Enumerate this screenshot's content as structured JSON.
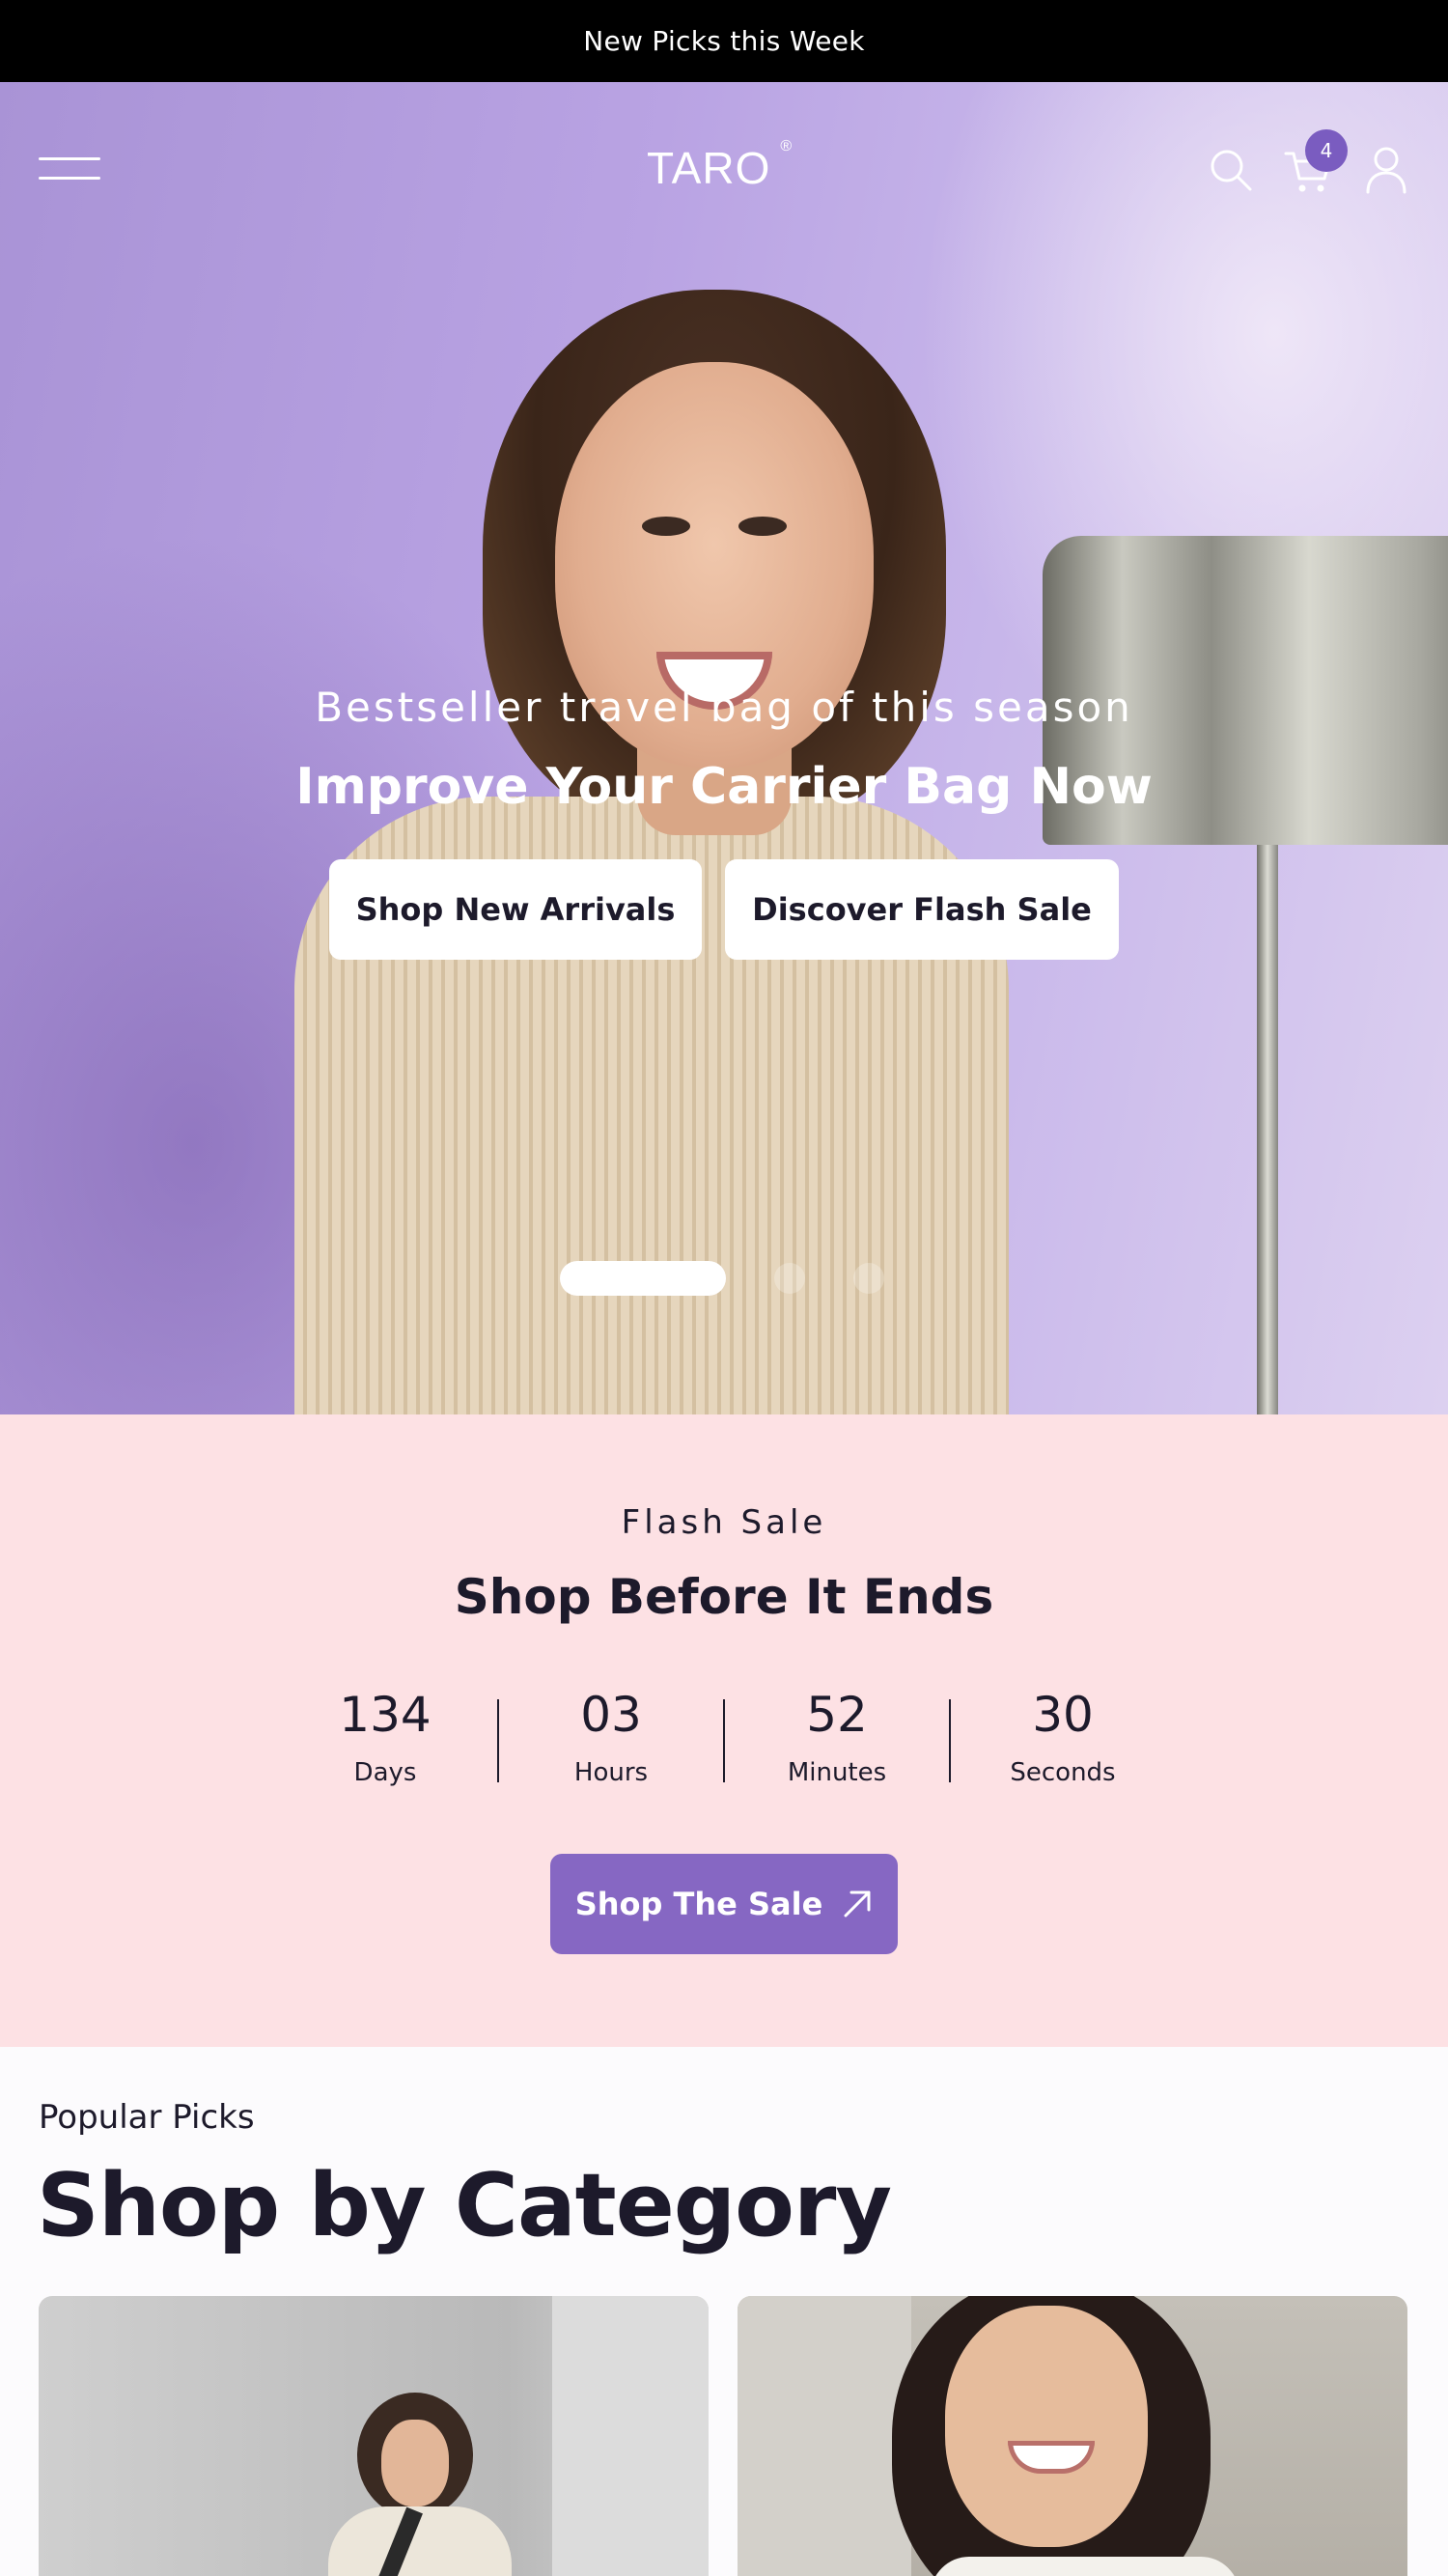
{
  "announcement": {
    "text": "New Picks this Week"
  },
  "header": {
    "logo": "TARO",
    "logo_mark": "®",
    "cart_count": "4",
    "icons": [
      "menu-icon",
      "search-icon",
      "cart-icon",
      "user-icon"
    ]
  },
  "hero": {
    "subtitle": "Bestseller travel bag of this season",
    "title": "Improve Your Carrier Bag Now",
    "buttons": {
      "primary": "Shop New Arrivals",
      "secondary": "Discover Flash Sale"
    },
    "slides": {
      "count": 3,
      "active": 1
    }
  },
  "flash_sale": {
    "label": "Flash Sale",
    "title": "Shop Before It Ends",
    "countdown": [
      {
        "value": "134",
        "unit": "Days"
      },
      {
        "value": "03",
        "unit": "Hours"
      },
      {
        "value": "52",
        "unit": "Minutes"
      },
      {
        "value": "30",
        "unit": "Seconds"
      }
    ],
    "button": "Shop The Sale",
    "button_icon": "arrow-up-right-icon",
    "colors": {
      "background": "#fde1e4",
      "button": "#8667c3"
    }
  },
  "categories": {
    "label": "Popular Picks",
    "title": "Shop by Category"
  }
}
